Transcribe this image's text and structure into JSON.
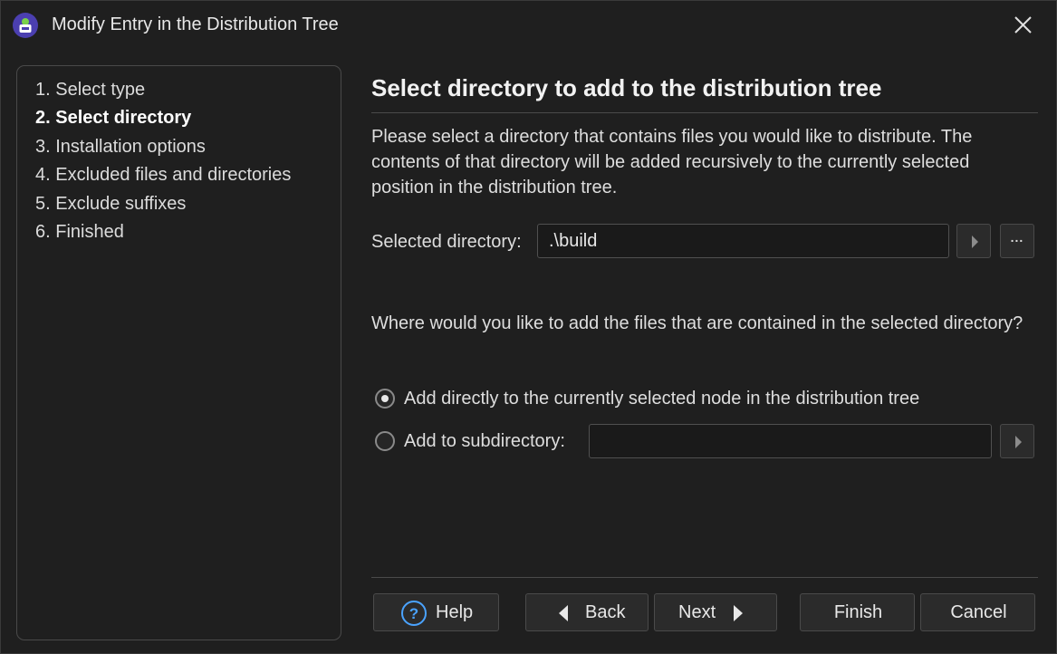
{
  "window": {
    "title": "Modify Entry in the Distribution Tree"
  },
  "steps": [
    {
      "label": "1. Select type",
      "active": false
    },
    {
      "label": "2. Select directory",
      "active": true
    },
    {
      "label": "3. Installation options",
      "active": false
    },
    {
      "label": "4. Excluded files and directories",
      "active": false
    },
    {
      "label": "5. Exclude suffixes",
      "active": false
    },
    {
      "label": "6. Finished",
      "active": false
    }
  ],
  "main": {
    "heading": "Select directory to add to the distribution tree",
    "description": "Please select a directory that contains files you would like to distribute. The contents of that directory will be added recursively to the currently selected position in the distribution tree.",
    "directory_label": "Selected directory:",
    "directory_value": ".\\build",
    "browse_label": "...",
    "question": "Where would you like to add the files that are contained in the selected directory?",
    "option_direct": "Add directly to the currently selected node in the distribution tree",
    "option_subdir": "Add to subdirectory:",
    "subdir_value": "",
    "selected_option": "direct"
  },
  "buttons": {
    "help": "Help",
    "back": "Back",
    "next": "Next",
    "finish": "Finish",
    "cancel": "Cancel"
  },
  "colors": {
    "accent": "#4aa3ff",
    "app_icon": "#4b3fb0"
  },
  "icons": {
    "app": "installer-app-icon",
    "close": "close-icon",
    "help": "help-circle-icon",
    "back": "triangle-left-icon",
    "next": "triangle-right-icon",
    "expand": "triangle-right-icon"
  }
}
